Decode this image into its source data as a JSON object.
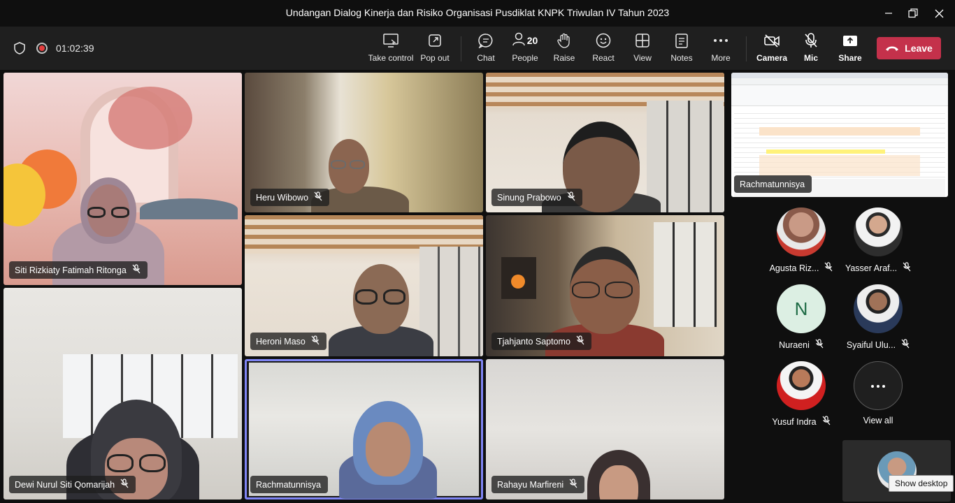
{
  "window": {
    "title": "Undangan Dialog Kinerja dan Risiko Organisasi Pusdiklat KNPK Triwulan IV Tahun 2023"
  },
  "meeting": {
    "timer": "01:02:39"
  },
  "toolbar": {
    "take_control": "Take control",
    "pop_out": "Pop out",
    "chat": "Chat",
    "people": "People",
    "people_count": "20",
    "raise": "Raise",
    "react": "React",
    "view": "View",
    "notes": "Notes",
    "more": "More",
    "camera": "Camera",
    "mic": "Mic",
    "share": "Share",
    "leave": "Leave"
  },
  "tiles": [
    {
      "name": "Siti Rizkiaty Fatimah Ritonga"
    },
    {
      "name": "Heru Wibowo"
    },
    {
      "name": "Sinung Prabowo"
    },
    {
      "name": "Heroni Maso"
    },
    {
      "name": "Tjahjanto Saptomo"
    },
    {
      "name": "Dewi Nurul Siti Qomarijah"
    },
    {
      "name": "Rachmatunnisya"
    },
    {
      "name": "Rahayu Marfireni"
    }
  ],
  "shared_screen": {
    "presenter": "Rachmatunnisya"
  },
  "roster": [
    {
      "name": "Agusta Riz..."
    },
    {
      "name": "Yasser Araf..."
    },
    {
      "name": "Nuraeni",
      "initial": "N"
    },
    {
      "name": "Syaiful Ulu..."
    },
    {
      "name": "Yusuf Indra"
    },
    {
      "name": "View all"
    }
  ],
  "tooltip": {
    "show_desktop": "Show desktop"
  },
  "colors": {
    "leave": "#c4314b",
    "active_speaker": "#7f85f5",
    "recording": "#e53e3e"
  }
}
